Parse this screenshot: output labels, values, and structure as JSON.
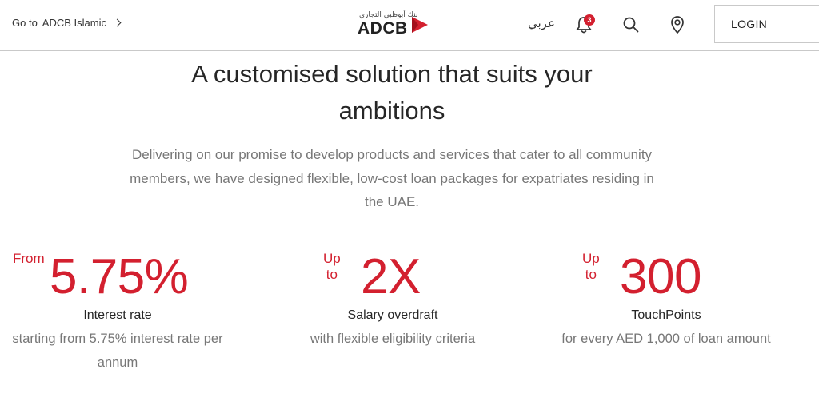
{
  "header": {
    "goto_prefix": "Go to",
    "goto_target": "ADCB Islamic",
    "logo_arabic": "بنك أبوظبي التجاري",
    "logo_text": "ADCB",
    "language_link": "عربي",
    "notification_count": "3",
    "login_label": "LOGIN",
    "icons": [
      "chevron-right-icon",
      "bell-icon",
      "search-icon",
      "location-pin-icon"
    ],
    "brand_color": "#d3202f"
  },
  "main": {
    "title_line1": "A customised solution that suits your",
    "title_line2": "ambitions",
    "description": "Delivering on our promise to develop products and services that cater to all community members, we have designed flexible, low-cost loan packages for expatriates residing in the UAE.",
    "stats": [
      {
        "prefix": "From",
        "value": "5.75%",
        "label": "Interest rate",
        "sub_line1": "starting from 5.75% interest rate per",
        "sub_line2": "annum"
      },
      {
        "prefix": "Up to",
        "value": "2X",
        "label": "Salary overdraft",
        "sub_line1": "with flexible eligibility criteria"
      },
      {
        "prefix": "Up to",
        "value": "300",
        "label": "TouchPoints",
        "sub_line1": "for every AED 1,000 of loan amount"
      }
    ]
  }
}
